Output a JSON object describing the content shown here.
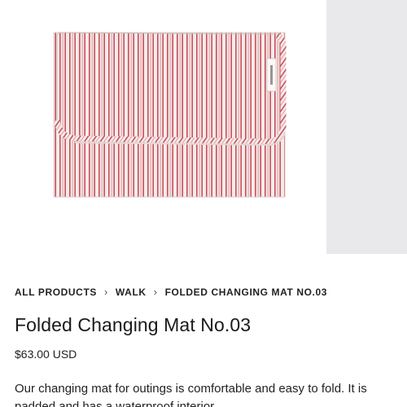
{
  "gallery": {
    "main_image_alt": "Folded changing mat with red and pink stripes",
    "stripe_colors": {
      "base": "#f4ecea",
      "red": "#c9505c",
      "pink": "#e4a3ac",
      "shadow": "#d9cfcd"
    },
    "side_image_color": "#e9e9eb"
  },
  "breadcrumb": {
    "items": [
      {
        "label": "ALL PRODUCTS"
      },
      {
        "label": "WALK"
      },
      {
        "label": "FOLDED CHANGING MAT NO.03"
      }
    ],
    "separator_icon": "chevron-right-icon"
  },
  "product": {
    "title": "Folded Changing Mat No.03",
    "price": "$63.00 USD",
    "description": "Our changing mat for outings is comfortable and easy to fold. It is padded and has a waterproof interior."
  }
}
